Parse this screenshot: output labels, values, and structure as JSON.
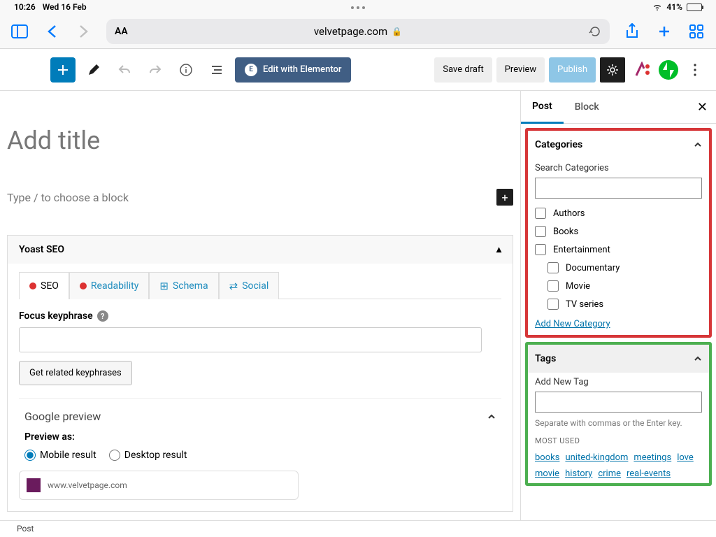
{
  "status": {
    "time": "10:26",
    "date": "Wed 16 Feb",
    "battery_pct": "41%"
  },
  "safari": {
    "url": "velvetpage.com"
  },
  "toolbar": {
    "elementor": "Edit with Elementor",
    "save_draft": "Save draft",
    "preview": "Preview",
    "publish": "Publish"
  },
  "editor": {
    "title_placeholder": "Add title",
    "block_placeholder": "Type / to choose a block"
  },
  "yoast": {
    "panel_title": "Yoast SEO",
    "tabs": {
      "seo": "SEO",
      "readability": "Readability",
      "schema": "Schema",
      "social": "Social"
    },
    "focus_label": "Focus keyphrase",
    "related_btn": "Get related keyphrases",
    "google_preview": "Google preview",
    "preview_as": "Preview as:",
    "mobile": "Mobile result",
    "desktop": "Desktop result",
    "snippet_url": "www.velvetpage.com"
  },
  "sidebar": {
    "tab_post": "Post",
    "tab_block": "Block",
    "categories": {
      "title": "Categories",
      "search_label": "Search Categories",
      "items": [
        {
          "label": "Authors",
          "indent": false
        },
        {
          "label": "Books",
          "indent": false
        },
        {
          "label": "Entertainment",
          "indent": false
        },
        {
          "label": "Documentary",
          "indent": true
        },
        {
          "label": "Movie",
          "indent": true
        },
        {
          "label": "TV series",
          "indent": true
        }
      ],
      "add_new": "Add New Category"
    },
    "tags": {
      "title": "Tags",
      "add_label": "Add New Tag",
      "hint": "Separate with commas or the Enter key.",
      "most_used_label": "MOST USED",
      "most_used": [
        "books",
        "united-kingdom",
        "meetings",
        "love",
        "movie",
        "history",
        "crime",
        "real-events"
      ]
    }
  },
  "footer": {
    "breadcrumb": "Post"
  }
}
